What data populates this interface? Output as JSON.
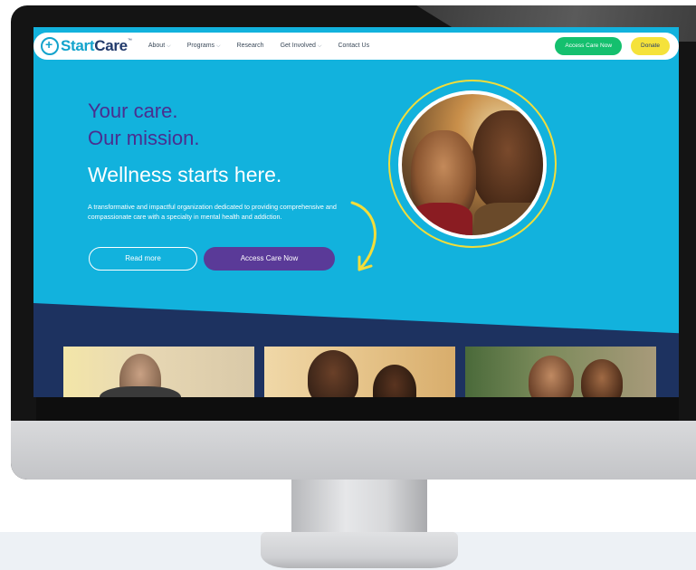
{
  "nav": {
    "logo_start": "Start",
    "logo_care": "Care",
    "logo_tm": "™",
    "links": [
      {
        "label": "About",
        "has_dropdown": true
      },
      {
        "label": "Programs",
        "has_dropdown": true
      },
      {
        "label": "Research",
        "has_dropdown": false
      },
      {
        "label": "Get Involved",
        "has_dropdown": true
      },
      {
        "label": "Contact Us",
        "has_dropdown": false
      }
    ],
    "cta_access": "Access Care Now",
    "cta_donate": "Donate"
  },
  "hero": {
    "line1": "Your care.",
    "line2": "Our mission.",
    "line3": "Wellness starts here.",
    "description": "A transformative and impactful organization dedicated to providing comprehensive and compassionate care with a specialty in mental health and addiction.",
    "read_more": "Read more",
    "access_care": "Access Care Now"
  },
  "colors": {
    "hero_bg": "#12b2dd",
    "heading_purple": "#4a2e8f",
    "button_purple": "#5a3a98",
    "nav_green": "#14c06e",
    "donate_yellow": "#f5e23a",
    "band_navy": "#1d3260",
    "accent_yellow": "#f2dd3a"
  },
  "icons": {
    "logo_mark": "plus-circle-icon",
    "dropdown": "chevron-down-icon",
    "hero_arrow": "curved-arrow-icon"
  }
}
